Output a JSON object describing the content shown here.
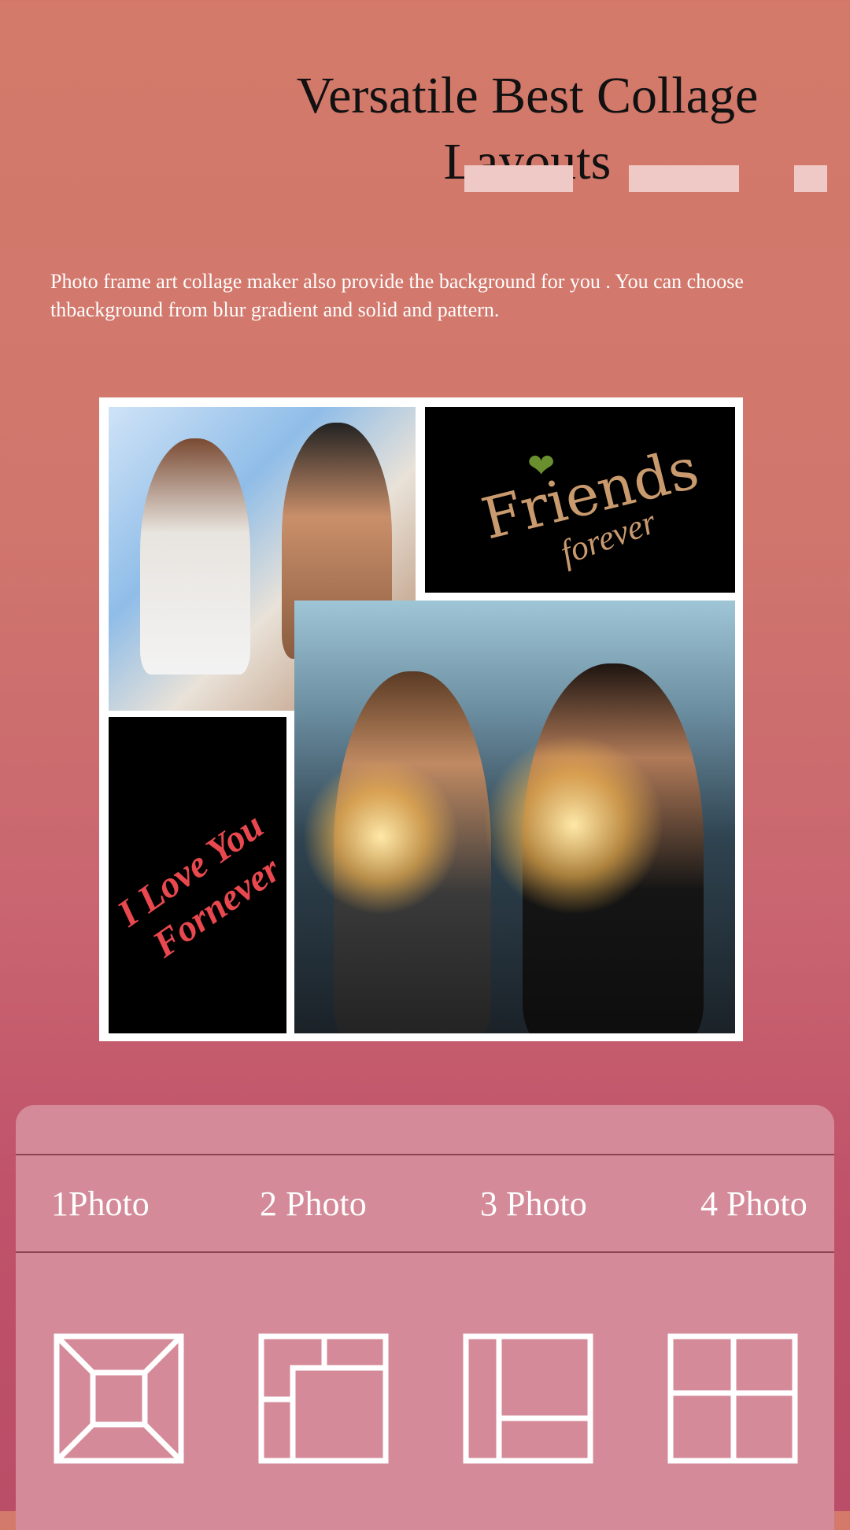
{
  "header": {
    "title_line1": "Versatile Best Collage",
    "title_line2": "Layouts"
  },
  "description": "Photo frame art collage maker also provide the background for you . You can choose thbackground from blur gradient and solid and pattern.",
  "collage": {
    "friends_text": "Friends",
    "forever_text": "forever",
    "love_line1": "I Love You",
    "love_line2": "Fornever"
  },
  "tabs": [
    {
      "label": "1Photo"
    },
    {
      "label": "2 Photo"
    },
    {
      "label": "3 Photo"
    },
    {
      "label": "4 Photo"
    }
  ],
  "colors": {
    "panel": "#d48a98",
    "highlight": "#efc9c5",
    "divider": "#8f4251"
  }
}
